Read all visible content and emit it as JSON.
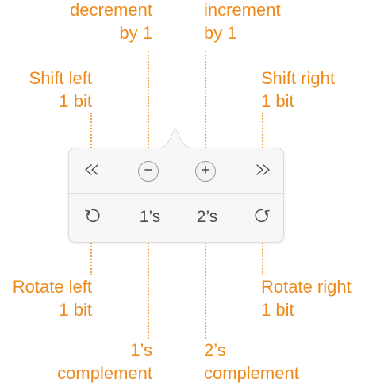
{
  "callouts": {
    "decrement": {
      "line1": "decrement",
      "line2": "by 1"
    },
    "increment": {
      "line1": "increment",
      "line2": "by 1"
    },
    "shift_left": {
      "line1": "Shift left",
      "line2": "1 bit"
    },
    "shift_right": {
      "line1": "Shift right",
      "line2": "1 bit"
    },
    "rotate_left": {
      "line1": "Rotate left",
      "line2": "1 bit"
    },
    "rotate_right": {
      "line1": "Rotate right",
      "line2": "1 bit"
    },
    "ones_complement": {
      "line1": "1’s",
      "line2": "complement"
    },
    "twos_complement": {
      "line1": "2’s",
      "line2": "complement"
    }
  },
  "popover": {
    "top_row": {
      "shift_left_icon": "shift-left-icon",
      "decrement_icon": "minus-icon",
      "increment_icon": "plus-icon",
      "shift_right_icon": "shift-right-icon"
    },
    "bottom_row": {
      "rotate_left_icon": "rotate-left-icon",
      "ones_label": "1’s",
      "twos_label": "2’s",
      "rotate_right_icon": "rotate-right-icon"
    }
  },
  "colors": {
    "callout_text": "#ee8a1c",
    "leader_line": "#f2a24a",
    "icon": "#4a4a4a"
  }
}
